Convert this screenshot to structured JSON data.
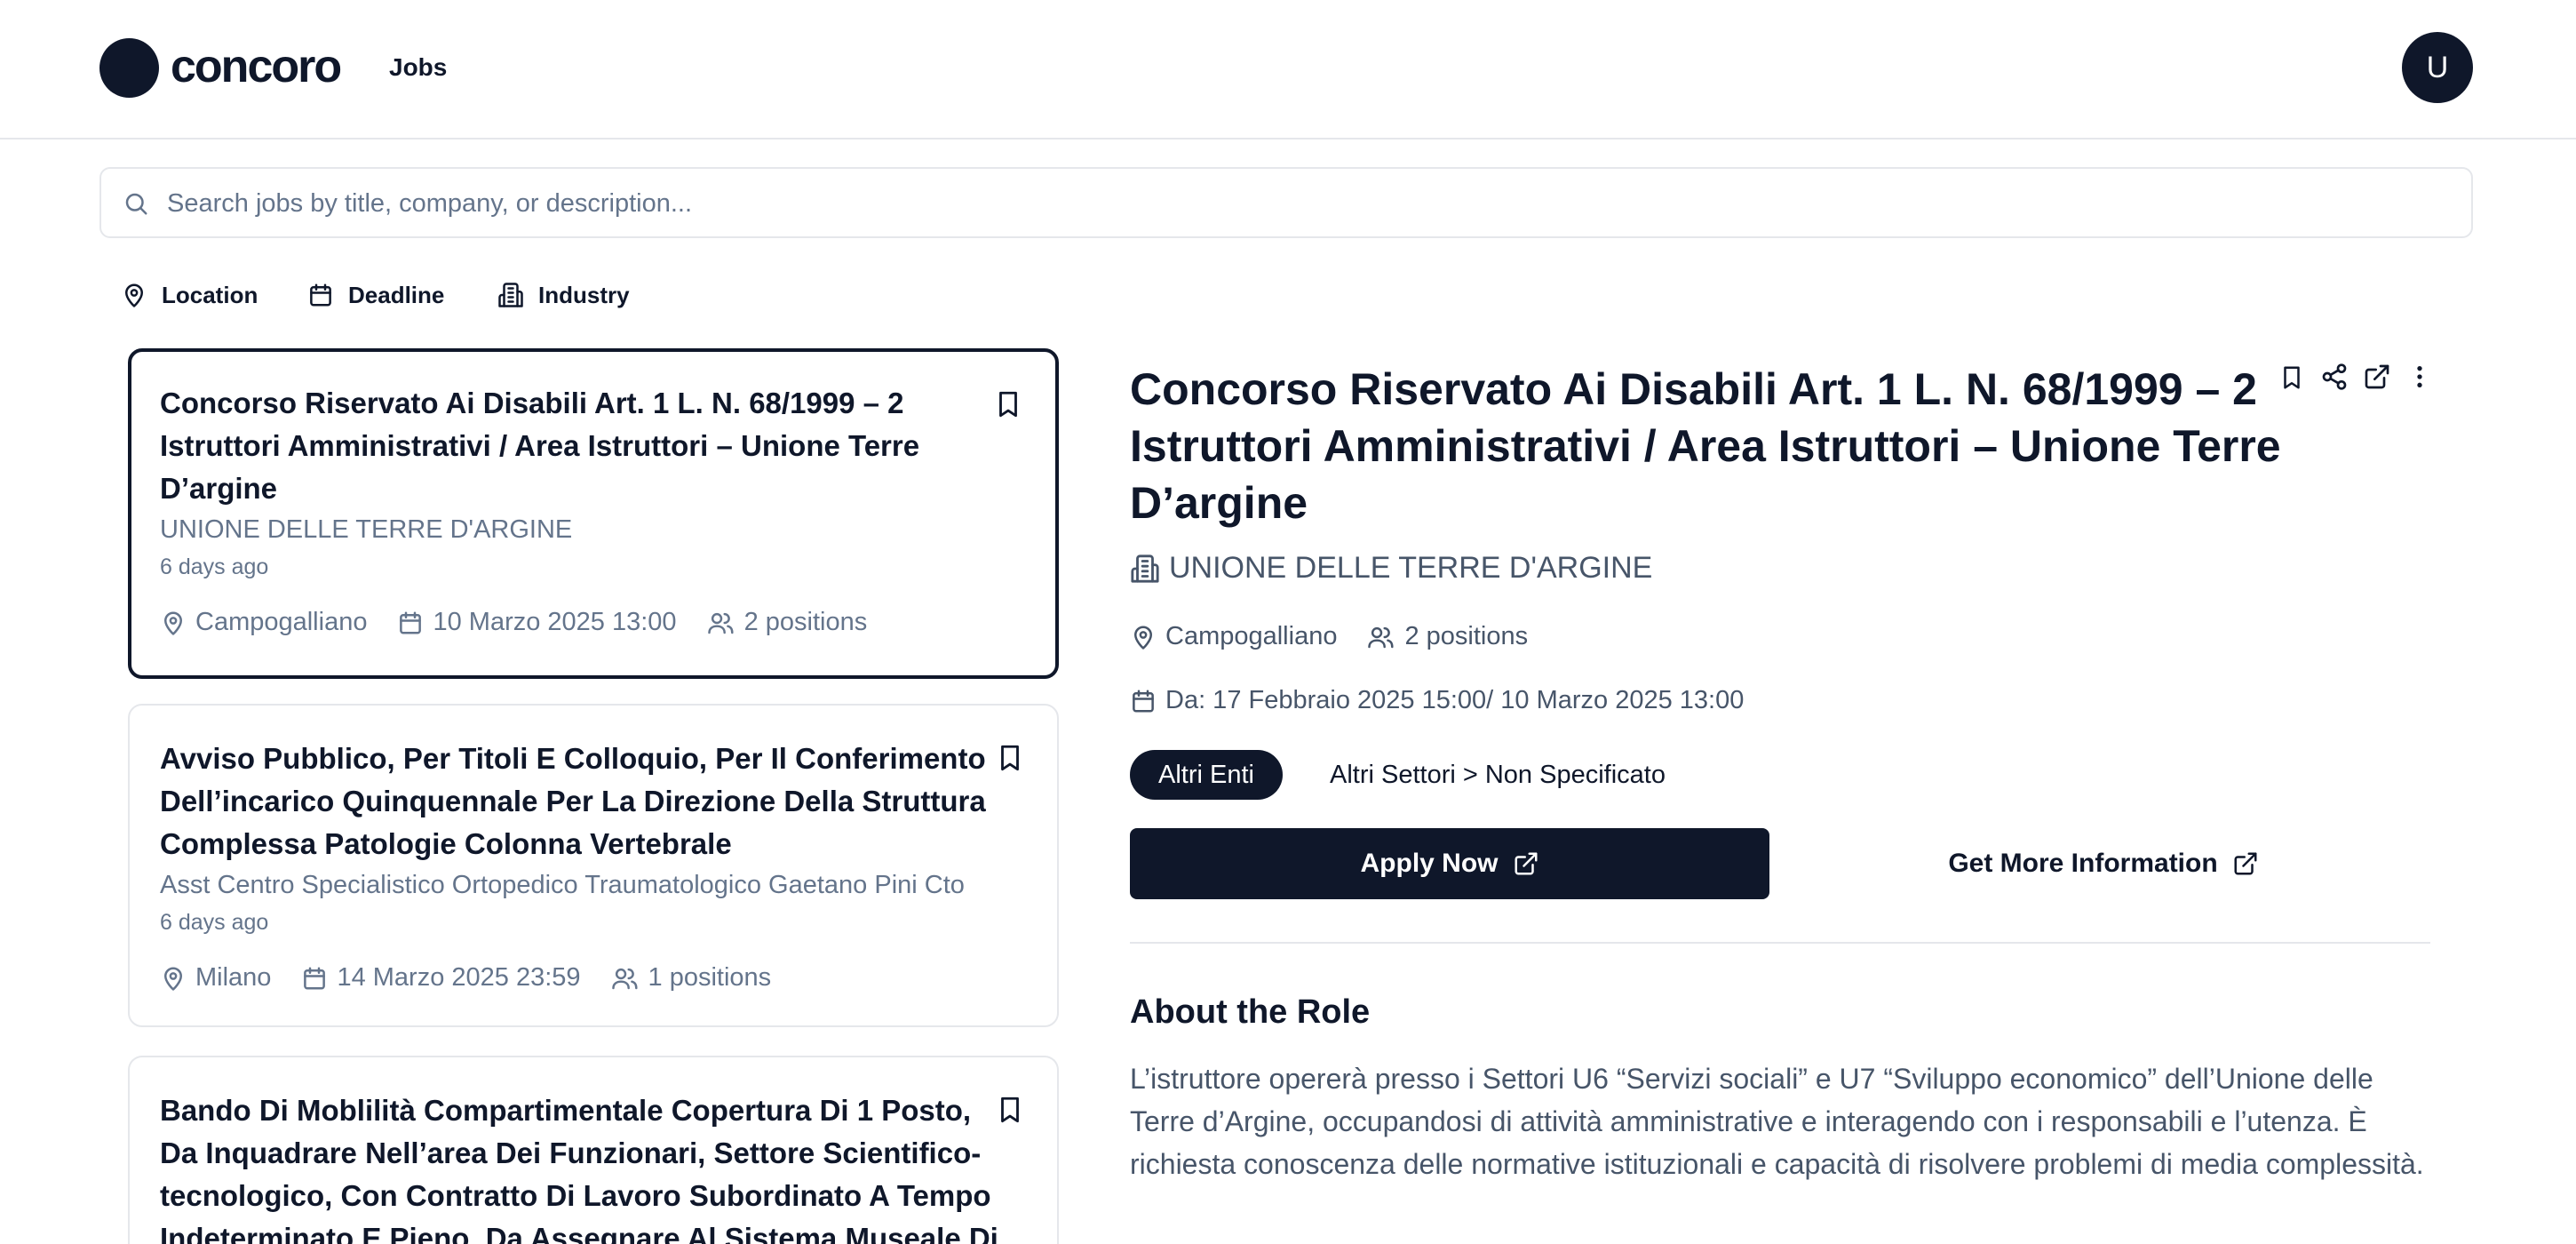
{
  "header": {
    "logo_text": "concoro",
    "nav_jobs": "Jobs",
    "avatar_initial": "U"
  },
  "search": {
    "placeholder": "Search jobs by title, company, or description...",
    "value": ""
  },
  "filters": [
    {
      "label": "Location",
      "icon": "map-pin-icon"
    },
    {
      "label": "Deadline",
      "icon": "calendar-icon"
    },
    {
      "label": "Industry",
      "icon": "building-icon"
    }
  ],
  "jobs": [
    {
      "title": "Concorso Riservato Ai Disabili Art. 1 L. N. 68/1999 – 2 Istruttori Amministrativi / Area Istruttori – Unione Terre D’argine",
      "company": "UNIONE DELLE TERRE D'ARGINE",
      "age": "6 days ago",
      "location": "Campogalliano",
      "deadline": "10 Marzo 2025 13:00",
      "positions": "2 positions",
      "selected": true
    },
    {
      "title": "Avviso Pubblico, Per Titoli E Colloquio, Per Il Conferimento Dell’incarico Quinquennale Per La Direzione Della Struttura Complessa Patologie Colonna Vertebrale",
      "company": "Asst Centro Specialistico Ortopedico Traumatologico Gaetano Pini Cto",
      "age": "6 days ago",
      "location": "Milano",
      "deadline": "14 Marzo 2025 23:59",
      "positions": "1 positions",
      "selected": false
    },
    {
      "title": "Bando Di Moblilità Compartimentale Copertura Di 1 Posto, Da Inquadrare Nell’area Dei Funzionari, Settore Scientifico-tecnologico, Con Contratto Di Lavoro Subordinato A Tempo Indeterminato E Pieno, Da Assegnare Al Sistema Museale Di",
      "selected": false
    }
  ],
  "detail": {
    "title": "Concorso Riservato Ai Disabili Art. 1 L. N. 68/1999 – 2 Istruttori Amministrativi / Area Istruttori – Unione Terre D’argine",
    "company": "UNIONE DELLE TERRE D'ARGINE",
    "location": "Campogalliano",
    "positions": "2 positions",
    "dates": "Da: 17 Febbraio 2025 15:00/ 10 Marzo 2025 13:00",
    "pill": "Altri Enti",
    "sector": "Altri Settori > Non Specificato",
    "apply_label": "Apply Now",
    "info_label": "Get More Information",
    "about_heading": "About the Role",
    "about_text": "L’istruttore opererà presso i Settori U6 “Servizi sociali” e U7 “Sviluppo economico” dell’Unione delle Terre d’Argine, occupandosi di attività amministrative e interagendo con i responsabili e l’utenza. È richiesta conoscenza delle normative istituzionali e capacità di risolvere problemi di media complessità."
  },
  "colors": {
    "primary": "#0f172a",
    "muted": "#64748b",
    "border": "#e5e7eb"
  }
}
